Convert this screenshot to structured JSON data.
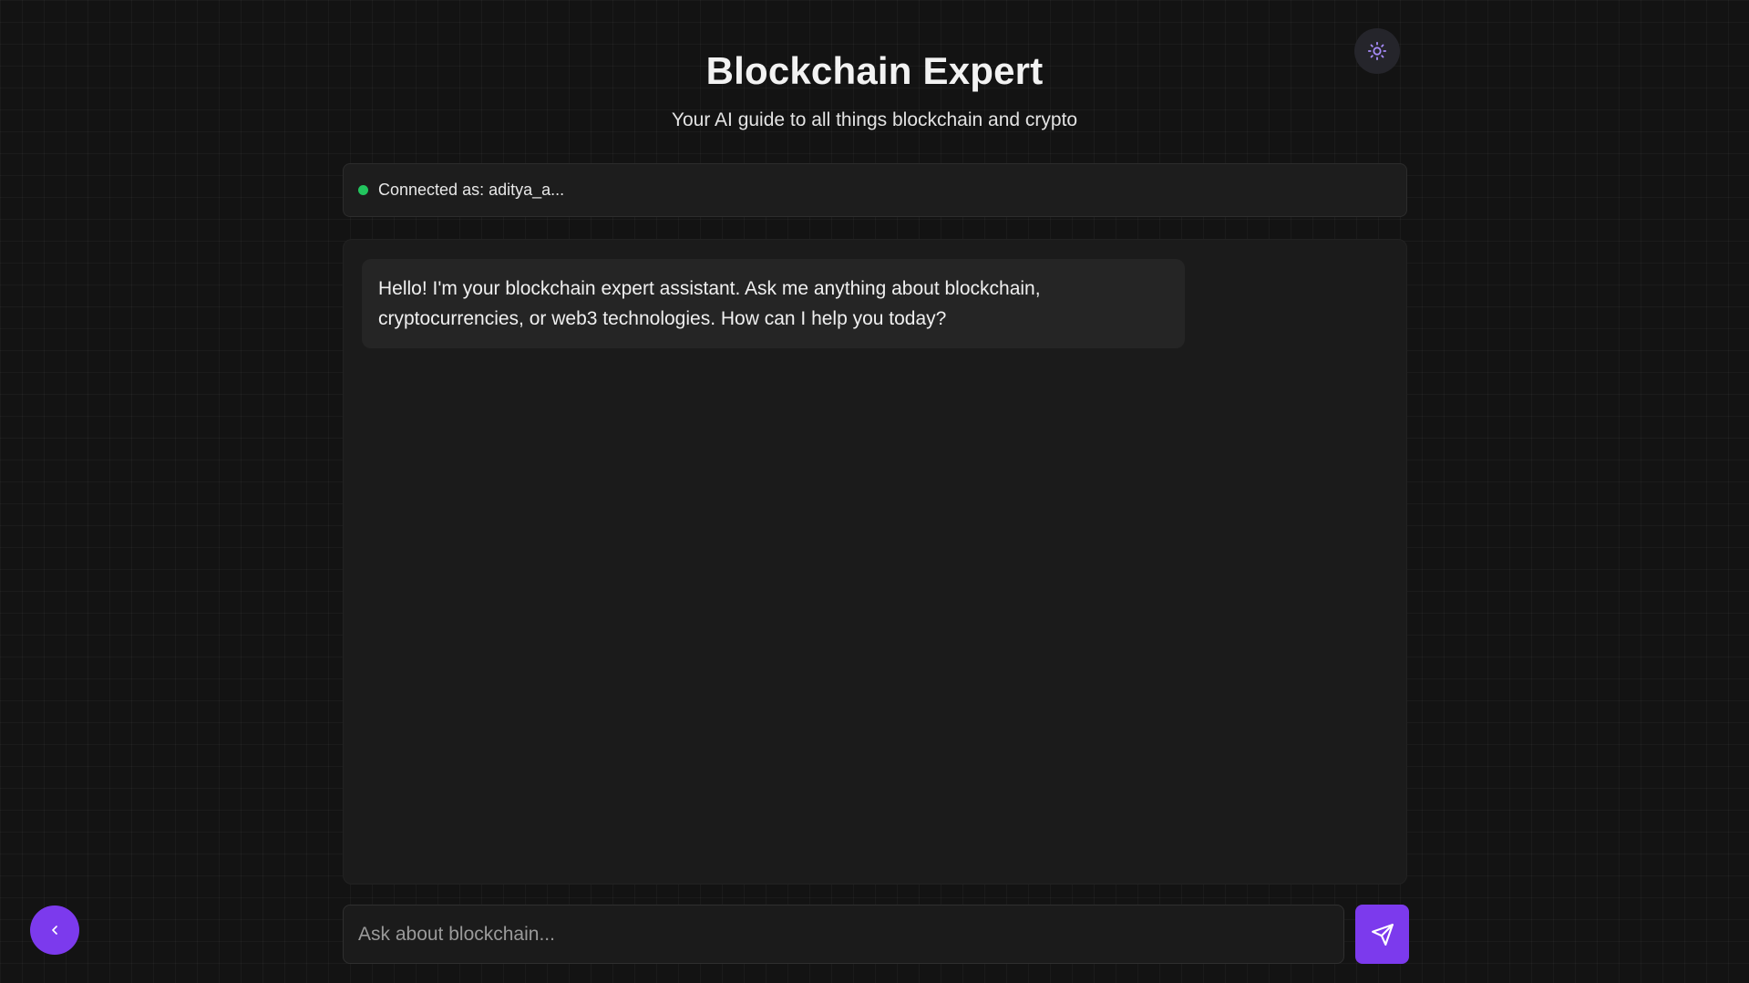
{
  "header": {
    "title": "Blockchain Expert",
    "subtitle": "Your AI guide to all things blockchain and crypto"
  },
  "theme_toggle": {
    "icon": "sun-icon"
  },
  "status": {
    "text": "Connected as: aditya_a...",
    "dot_color": "#22c55e"
  },
  "chat": {
    "messages": [
      {
        "role": "assistant",
        "text": "Hello! I'm your blockchain expert assistant. Ask me anything about blockchain, cryptocurrencies, or web3 technologies. How can I help you today?"
      }
    ]
  },
  "composer": {
    "placeholder": "Ask about blockchain...",
    "value": "",
    "send_icon": "send-icon"
  },
  "navigation": {
    "back_icon": "chevron-left-icon"
  },
  "colors": {
    "accent": "#7c3aed",
    "background": "#131313",
    "panel": "#1b1b1b",
    "bubble": "#252525"
  }
}
